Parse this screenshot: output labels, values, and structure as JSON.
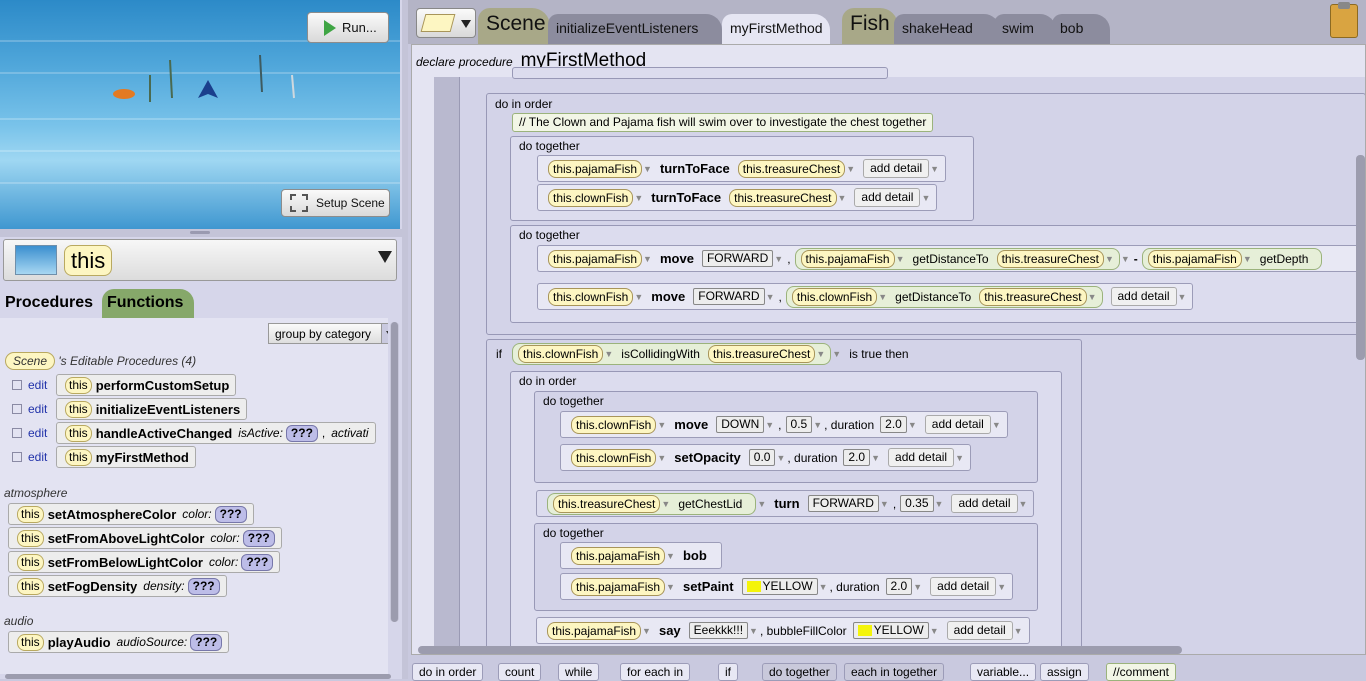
{
  "scene_view": {
    "run_label": "Run...",
    "setup_scene_label": "Setup Scene"
  },
  "selector": {
    "object": "this"
  },
  "left_tabs": {
    "procedures": "Procedures",
    "functions": "Functions"
  },
  "group_by": "group by category",
  "scene_pill": "Scene",
  "editable_header": "'s Editable Procedures (4)",
  "edit_label": "edit",
  "this_label": "this",
  "editable_procs": [
    {
      "name": "performCustomSetup"
    },
    {
      "name": "initializeEventListeners"
    },
    {
      "name": "handleActiveChanged",
      "param": "isActive:",
      "param_value": "???",
      "param2": "activati"
    },
    {
      "name": "myFirstMethod"
    }
  ],
  "categories": {
    "atmosphere": "atmosphere",
    "audio": "audio"
  },
  "atmosphere_procs": [
    {
      "name": "setAtmosphereColor",
      "param": "color:",
      "value": "???"
    },
    {
      "name": "setFromAboveLightColor",
      "param": "color:",
      "value": "???"
    },
    {
      "name": "setFromBelowLightColor",
      "param": "color:",
      "value": "???"
    },
    {
      "name": "setFogDensity",
      "param": "density:",
      "value": "???"
    }
  ],
  "audio_procs": [
    {
      "name": "playAudio",
      "param": "audioSource:",
      "value": "???"
    }
  ],
  "tabs": {
    "scene": "Scene",
    "initialize": "initializeEventListeners",
    "my_first_method": "myFirstMethod",
    "fish": "Fish",
    "shake_head": "shakeHead",
    "swim": "swim",
    "bob": "bob"
  },
  "editor": {
    "declare_label": "declare procedure",
    "method_name": "myFirstMethod",
    "do_in_order": "do in order",
    "do_together": "do together",
    "comment": "// The Clown and Pajama fish will swim over to investigate the chest together",
    "add_detail": "add detail",
    "if_label": "if",
    "is_true_then": "is true then",
    "duration_label": ", duration",
    "bubble_label": ", bubbleFillColor",
    "objects": {
      "pajama": "this.pajamaFish",
      "clown": "this.clownFish",
      "chest": "this.treasureChest"
    },
    "methods": {
      "turn_to_face": "turnToFace",
      "move": "move",
      "get_distance_to": "getDistanceTo",
      "get_depth": "getDepth",
      "is_colliding_with": "isCollidingWith",
      "set_opacity": "setOpacity",
      "get_chest_lid": "getChestLid",
      "turn": "turn",
      "bob": "bob",
      "set_paint": "setPaint",
      "say": "say"
    },
    "values": {
      "forward": "FORWARD",
      "down": "DOWN",
      "half": "0.5",
      "two": "2.0",
      "zero": "0.0",
      "pt35": "0.35",
      "yellow": "YELLOW",
      "eeek": "Eeekkk!!!",
      "minus": "-"
    }
  },
  "templates": [
    "do in order",
    "count",
    "while",
    "for each in",
    "if",
    "do together",
    "each in together",
    "variable...",
    "assign",
    "//comment"
  ],
  "colors": {
    "object_pill": "#fdf6c2",
    "function_pill": "#d9ecc6",
    "yellow_swatch": "#f4f40a",
    "functions_tab": "#86a86a"
  }
}
